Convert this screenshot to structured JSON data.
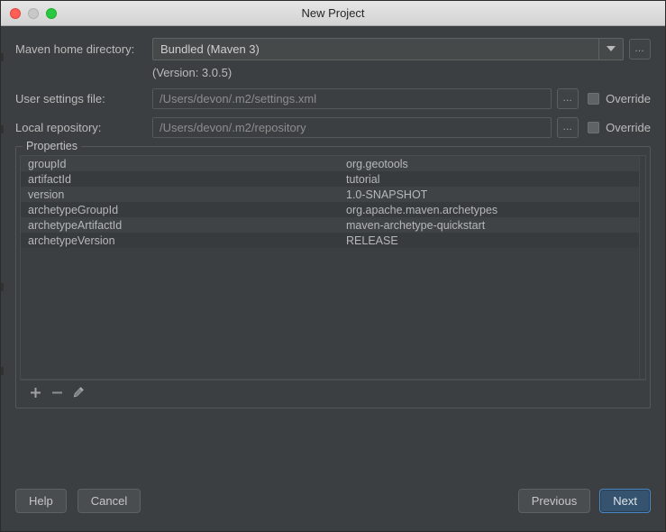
{
  "window": {
    "title": "New Project",
    "traffic_lights": [
      "close-button",
      "minimize-button",
      "zoom-button"
    ]
  },
  "form": {
    "maven_home": {
      "label": "Maven home directory:",
      "value": "Bundled (Maven 3)",
      "dropdown_icon": "chevron-down-icon",
      "browse_label": "…"
    },
    "version_note": "(Version: 3.0.5)",
    "user_settings": {
      "label": "User settings file:",
      "value": "/Users/devon/.m2/settings.xml",
      "browse_label": "…",
      "override_label": "Override",
      "override_checked": false
    },
    "local_repository": {
      "label": "Local repository:",
      "value": "/Users/devon/.m2/repository",
      "browse_label": "…",
      "override_label": "Override",
      "override_checked": false
    }
  },
  "properties": {
    "title": "Properties",
    "rows": [
      {
        "key": "groupId",
        "value": "org.geotools"
      },
      {
        "key": "artifactId",
        "value": "tutorial"
      },
      {
        "key": "version",
        "value": "1.0-SNAPSHOT"
      },
      {
        "key": "archetypeGroupId",
        "value": "org.apache.maven.archetypes"
      },
      {
        "key": "archetypeArtifactId",
        "value": "maven-archetype-quickstart"
      },
      {
        "key": "archetypeVersion",
        "value": "RELEASE"
      }
    ],
    "toolbar": [
      {
        "name": "add-property-button",
        "glyph": "+"
      },
      {
        "name": "remove-property-button",
        "glyph": "−"
      },
      {
        "name": "edit-property-button",
        "glyph": "pencil-icon"
      }
    ]
  },
  "footer": {
    "help_label": "Help",
    "cancel_label": "Cancel",
    "previous_label": "Previous",
    "next_label": "Next"
  },
  "colors": {
    "window_background": "#3c3f41",
    "titlebar": "#dcdcdc",
    "text_primary": "#bbbbbb",
    "text_disabled": "#8d8d8d",
    "accent_primary_button": "#35536e",
    "accent_primary_border": "#4a87c4",
    "row_odd": "#3f4345",
    "row_even": "#383b3d"
  }
}
